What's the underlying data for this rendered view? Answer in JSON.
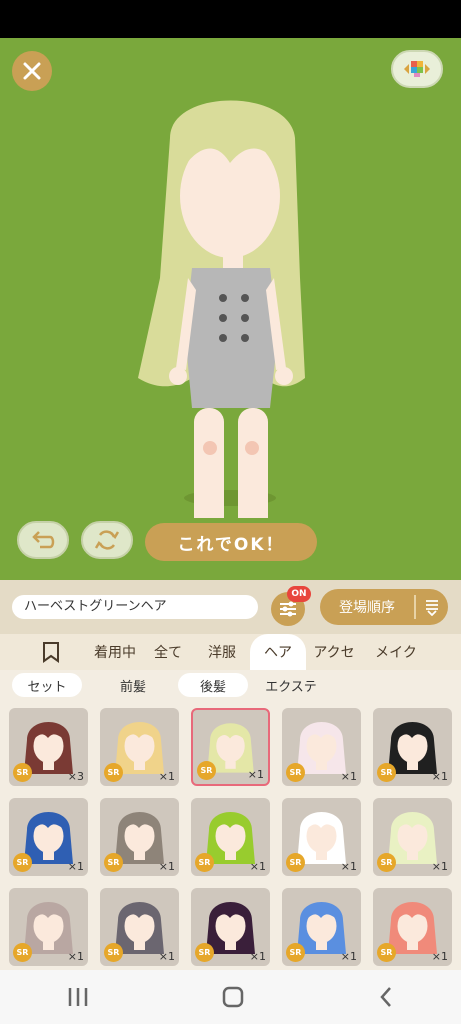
{
  "actions": {
    "ok_label": "これでOK！"
  },
  "toolbar": {
    "item_name": "ハーベストグリーンヘア",
    "filter_badge": "ON",
    "sort_label": "登場順序"
  },
  "tabs": [
    "着用中",
    "全て",
    "洋服",
    "ヘア",
    "アクセ",
    "メイク"
  ],
  "active_tab": "ヘア",
  "subtabs": [
    "セット",
    "前髪",
    "後髪",
    "エクステ"
  ],
  "items": [
    {
      "hair": "#7a3a34",
      "rarity": "SR",
      "qty": "×3"
    },
    {
      "hair": "#f0d38a",
      "rarity": "SR",
      "qty": "×1"
    },
    {
      "hair": "#e4e7a7",
      "rarity": "SR",
      "qty": "×1",
      "selected": true
    },
    {
      "hair": "#f6e6ea",
      "rarity": "SR",
      "qty": "×1"
    },
    {
      "hair": "#202020",
      "rarity": "SR",
      "qty": "×1"
    },
    {
      "hair": "#2f5fb3",
      "rarity": "SR",
      "qty": "×1"
    },
    {
      "hair": "#8e8479",
      "rarity": "SR",
      "qty": "×1"
    },
    {
      "hair": "#98cc2e",
      "rarity": "SR",
      "qty": "×1"
    },
    {
      "hair": "#ffffff",
      "rarity": "SR",
      "qty": "×1"
    },
    {
      "hair": "#e9f1c3",
      "rarity": "SR",
      "qty": "×1"
    },
    {
      "hair": "#b9a7a2",
      "rarity": "SR",
      "qty": "×1"
    },
    {
      "hair": "#6b6670",
      "rarity": "SR",
      "qty": "×1"
    },
    {
      "hair": "#3a1f3a",
      "rarity": "SR",
      "qty": "×1"
    },
    {
      "hair": "#5a8fe0",
      "rarity": "SR",
      "qty": "×1"
    },
    {
      "hair": "#f08a7a",
      "rarity": "SR",
      "qty": "×1"
    }
  ],
  "colors": {
    "stage": "#7aa83c",
    "accent": "#c9a055",
    "badge": "#e8453c",
    "avatar_hair": "#d9dc9a"
  }
}
